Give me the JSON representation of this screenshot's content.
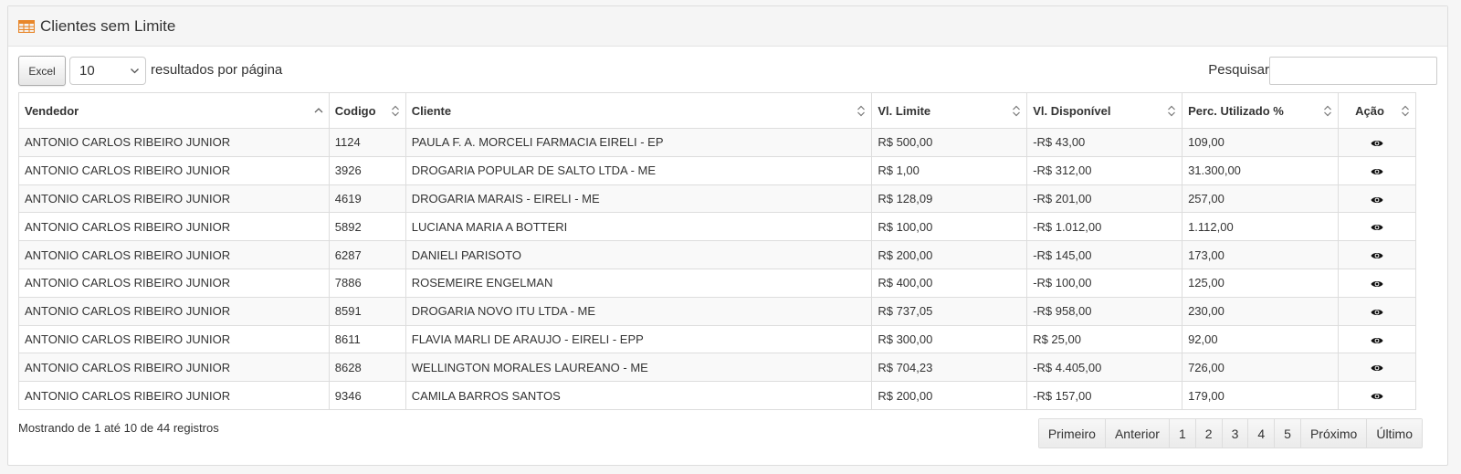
{
  "panel": {
    "title": "Clientes sem Limite",
    "icon": "table-icon"
  },
  "toolbar": {
    "excel_label": "Excel",
    "page_size_value": "10",
    "page_size_label": "resultados por página",
    "search_label": "Pesquisar",
    "search_value": ""
  },
  "table": {
    "columns": [
      "Vendedor",
      "Codigo",
      "Cliente",
      "Vl. Limite",
      "Vl. Disponível",
      "Perc. Utilizado %",
      "Ação"
    ],
    "sorted_column": "Vendedor",
    "sort_direction": "ascending",
    "rows": [
      [
        "ANTONIO CARLOS RIBEIRO JUNIOR",
        "1124",
        "PAULA F. A. MORCELI FARMACIA EIRELI - EP",
        "R$ 500,00",
        "-R$ 43,00",
        "109,00"
      ],
      [
        "ANTONIO CARLOS RIBEIRO JUNIOR",
        "3926",
        "DROGARIA POPULAR DE SALTO LTDA - ME",
        "R$ 1,00",
        "-R$ 312,00",
        "31.300,00"
      ],
      [
        "ANTONIO CARLOS RIBEIRO JUNIOR",
        "4619",
        "DROGARIA MARAIS - EIRELI - ME",
        "R$ 128,09",
        "-R$ 201,00",
        "257,00"
      ],
      [
        "ANTONIO CARLOS RIBEIRO JUNIOR",
        "5892",
        "LUCIANA MARIA A BOTTERI",
        "R$ 100,00",
        "-R$ 1.012,00",
        "1.112,00"
      ],
      [
        "ANTONIO CARLOS RIBEIRO JUNIOR",
        "6287",
        "DANIELI PARISOTO",
        "R$ 200,00",
        "-R$ 145,00",
        "173,00"
      ],
      [
        "ANTONIO CARLOS RIBEIRO JUNIOR",
        "7886",
        "ROSEMEIRE ENGELMAN",
        "R$ 400,00",
        "-R$ 100,00",
        "125,00"
      ],
      [
        "ANTONIO CARLOS RIBEIRO JUNIOR",
        "8591",
        "DROGARIA NOVO ITU LTDA - ME",
        "R$ 737,05",
        "-R$ 958,00",
        "230,00"
      ],
      [
        "ANTONIO CARLOS RIBEIRO JUNIOR",
        "8611",
        "FLAVIA MARLI DE ARAUJO - EIRELI - EPP",
        "R$ 300,00",
        "R$ 25,00",
        "92,00"
      ],
      [
        "ANTONIO CARLOS RIBEIRO JUNIOR",
        "8628",
        "WELLINGTON MORALES LAUREANO - ME",
        "R$ 704,23",
        "-R$ 4.405,00",
        "726,00"
      ],
      [
        "ANTONIO CARLOS RIBEIRO JUNIOR",
        "9346",
        "CAMILA BARROS SANTOS",
        "R$ 200,00",
        "-R$ 157,00",
        "179,00"
      ]
    ],
    "action_icon": "eye-icon"
  },
  "footer": {
    "info": "Mostrando de 1 até 10 de 44 registros",
    "pagination": [
      "Primeiro",
      "Anterior",
      "1",
      "2",
      "3",
      "4",
      "5",
      "Próximo",
      "Último"
    ]
  },
  "colors": {
    "icon_accent": "#e8872b",
    "border": "#dddddd",
    "stripe": "#f9f9f9"
  }
}
